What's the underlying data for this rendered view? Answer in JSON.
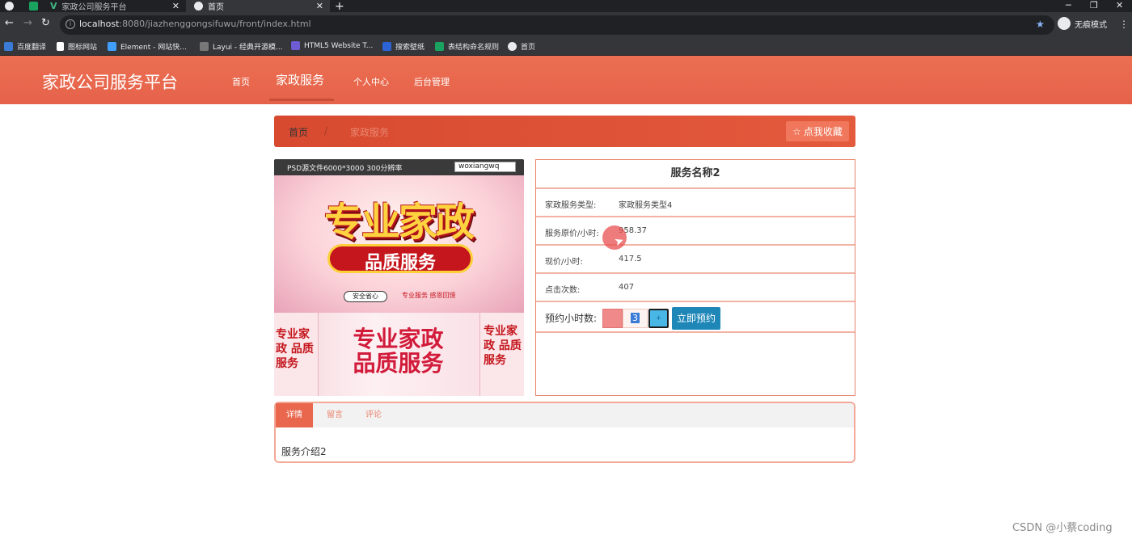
{
  "browser": {
    "tabs": [
      {
        "title": ""
      },
      {
        "title": ""
      },
      {
        "title": "家政公司服务平台"
      },
      {
        "title": "首页"
      }
    ],
    "new_tab": "+",
    "url_host": "localhost",
    "url_rest": ":8080/jiazhenggongsifuwu/front/index.html",
    "incognito_label": "无痕模式",
    "bookmarks": [
      {
        "label": "百度翻译",
        "color": "#3b7bd8"
      },
      {
        "label": "图标网站",
        "color": "#ffffff"
      },
      {
        "label": "Element - 网站快...",
        "color": "#409eff"
      },
      {
        "label": "Layui - 经典开源模...",
        "color": "#1e1e1e"
      },
      {
        "label": "HTML5 Website T...",
        "color": "#6f5bd3"
      },
      {
        "label": "搜索壁纸",
        "color": "#2c64d6"
      },
      {
        "label": "表结构命名规则",
        "color": "#1aa260"
      },
      {
        "label": "首页",
        "color": "#e8eaed"
      }
    ]
  },
  "site": {
    "brand": "家政公司服务平台",
    "nav": [
      {
        "label": "首页"
      },
      {
        "label": "家政服务"
      },
      {
        "label": "个人中心"
      },
      {
        "label": "后台管理"
      }
    ]
  },
  "breadcrumb": {
    "home": "首页",
    "separator": "/",
    "current": "家政服务",
    "favorite_label": "点我收藏"
  },
  "poster": {
    "band_text": "PSD源文件6000*3000  300分辨率",
    "band_tag": "woxiangwq",
    "title": "专业家政",
    "subtitle": "品质服务",
    "badge": "安全省心",
    "badge2": "专业服务  感恩回馈",
    "bottom_main": "专业家政 品质服务",
    "bottom_left": "专业家政 品质服务",
    "bottom_right": "专业家政 品质服务"
  },
  "service": {
    "name": "服务名称2",
    "rows": [
      {
        "label": "家政服务类型:",
        "value": "家政服务类型4"
      },
      {
        "label": "服务原价/小时:",
        "value": "958.37"
      },
      {
        "label": "现价/小时:",
        "value": "417.5"
      },
      {
        "label": "点击次数:",
        "value": "407"
      }
    ],
    "booking": {
      "label": "预约小时数:",
      "quantity": "3",
      "plus": "+",
      "button": "立即预约"
    }
  },
  "tabs": {
    "items": [
      {
        "label": "详情"
      },
      {
        "label": "留言"
      },
      {
        "label": "评论"
      }
    ],
    "active_content": "服务介绍2"
  },
  "watermark": "CSDN @小蔡coding",
  "colors": {
    "header": "#e9674c",
    "accent_button": "#1e87b8"
  }
}
